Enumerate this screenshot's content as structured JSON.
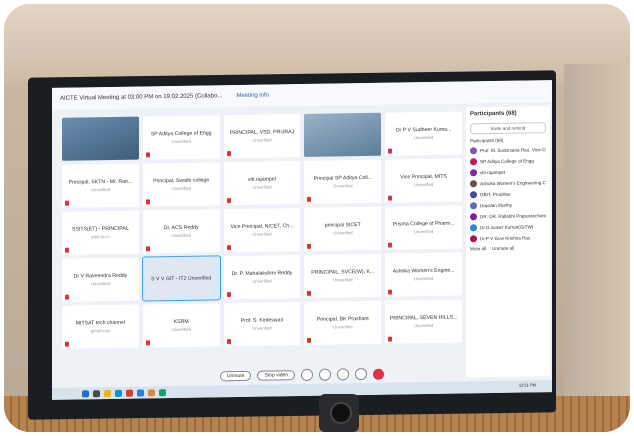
{
  "meeting": {
    "title": "AICTE Virtual Meeting at 03:00 PM on 19.02.2025 (Collabo...",
    "info_label": "Meeting info"
  },
  "tiles": [
    {
      "name": "",
      "status": "",
      "video": true
    },
    {
      "name": "SP Aditya College of Engg",
      "status": "Unverified"
    },
    {
      "name": "PRINCIPAL, VSD, PRIJRAJ",
      "status": "Unverified"
    },
    {
      "name": "",
      "status": "",
      "video": true
    },
    {
      "name": "Dr P V Sudheer Kuma...",
      "status": "Unverified"
    },
    {
      "name": "Principal, SKTN - Mr. Rao...",
      "status": "Unverified"
    },
    {
      "name": "Principal, Swathi college",
      "status": "Unverified"
    },
    {
      "name": "vitr.rajampet",
      "status": "Unverified"
    },
    {
      "name": "Principal SP Aditya Coll...",
      "status": "Unverified"
    },
    {
      "name": "Vice Principal, MITS",
      "status": "Unverified"
    },
    {
      "name": "SSITS(ET) - PRINCIPAL",
      "status": "pdrs.ac.in"
    },
    {
      "name": "Dr. ACS Reddy",
      "status": "Unverified"
    },
    {
      "name": "Vice Principal, NICET, Ch...",
      "status": "Unverified"
    },
    {
      "name": "principal SICET",
      "status": "Unverified"
    },
    {
      "name": "Prisma College of Pharm...",
      "status": "Unverified"
    },
    {
      "name": "Dr V Raveendra Reddy",
      "status": "Unverified"
    },
    {
      "name": "S V V GIT - IT2 Unverified",
      "status": "",
      "highlight": true
    },
    {
      "name": "Dr. P. Mahalakshmi Reddy",
      "status": "Unverified"
    },
    {
      "name": "PRINCIPAL, SVCE(W), K...",
      "status": "Unverified"
    },
    {
      "name": "Ashoka Women's Engine...",
      "status": "Unverified"
    },
    {
      "name": "MITSAT tech channel",
      "status": "gmail.com"
    },
    {
      "name": "KSRM",
      "status": "Unverified"
    },
    {
      "name": "Prof. S. Kiriteswari",
      "status": "Unverified"
    },
    {
      "name": "Principal, BK Prashant",
      "status": "Unverified"
    },
    {
      "name": "PRINCIPAL, SEVEN HILLS...",
      "status": "Unverified"
    }
  ],
  "panel": {
    "title": "Participants (68)",
    "invite": "Invite and remind",
    "section": "Participants (68)",
    "items": [
      {
        "name": "Prof. M. Sudarsana Rao, Vice-Ch...",
        "color": "#7a5ab8"
      },
      {
        "name": "SP Aditya College of Engg",
        "color": "#c2185b"
      },
      {
        "name": "vitr.rajampet",
        "color": "#8e24aa"
      },
      {
        "name": "Ashoka Women's Engineering C...",
        "color": "#6d4c41"
      },
      {
        "name": "GBIT, ProdAtur",
        "color": "#3949ab"
      },
      {
        "name": "Dayalan Murthy",
        "color": "#5c6bc0"
      },
      {
        "name": "DR. DR. Rallabhi Prapuranchandra",
        "color": "#7b1fa2"
      },
      {
        "name": "Dr.G.sumer Kumar(GITW)",
        "color": "#1e88e5"
      },
      {
        "name": "Dr.P V Guvi Krishna Rao",
        "color": "#ad1457"
      }
    ],
    "footer_left": "Mute all",
    "footer_right": "Unmute all"
  },
  "controls": {
    "unmute": "Unmute",
    "stop_video": "Stop video"
  },
  "taskbar": {
    "time": "12:51 PM"
  }
}
